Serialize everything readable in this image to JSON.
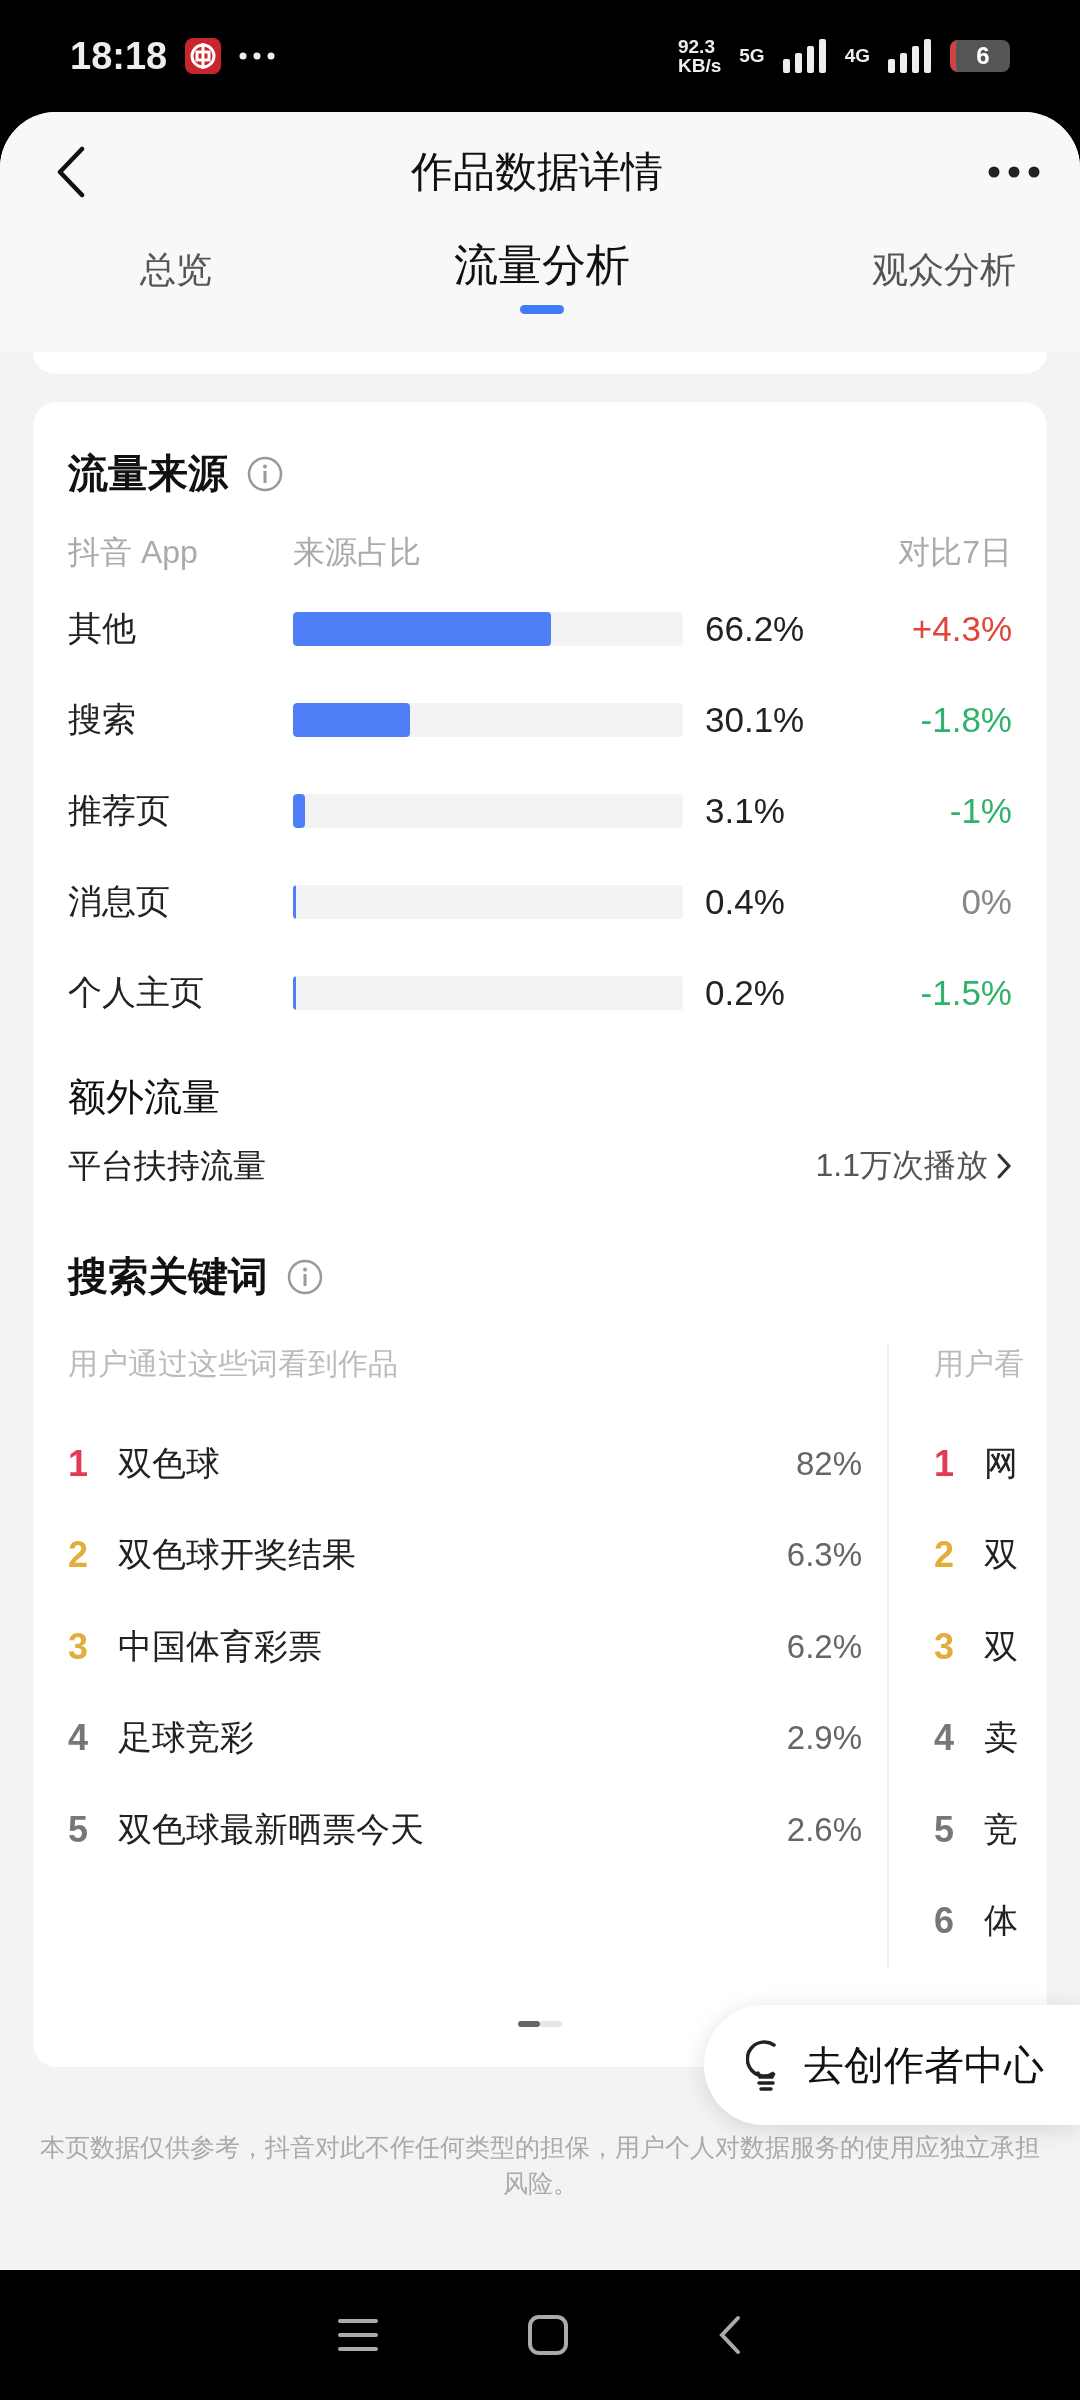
{
  "status_bar": {
    "time": "18:18",
    "net_speed": "92.3",
    "net_speed_unit": "KB/s",
    "sim1": "5G",
    "sim2": "4G",
    "battery": "6"
  },
  "header": {
    "title": "作品数据详情"
  },
  "tabs": [
    {
      "label": "总览",
      "selected": false
    },
    {
      "label": "流量分析",
      "selected": true
    },
    {
      "label": "观众分析",
      "selected": false
    }
  ],
  "traffic_sources": {
    "title": "流量来源",
    "columns": [
      "抖音 App",
      "来源占比",
      "对比7日"
    ],
    "rows": [
      {
        "name": "其他",
        "level": 0.662,
        "share": "66.2%",
        "change": "+4.3%",
        "color": "#e0453a"
      },
      {
        "name": "搜索",
        "level": 0.301,
        "share": "30.1%",
        "change": "-1.8%",
        "color": "#2fb36a"
      },
      {
        "name": "推荐页",
        "level": 0.031,
        "share": "3.1%",
        "change": "-1%",
        "color": "#2fb36a"
      },
      {
        "name": "消息页",
        "level": 0.004,
        "share": "0.4%",
        "change": "0%",
        "color": "#888888"
      },
      {
        "name": "个人主页",
        "level": 0.002,
        "share": "0.2%",
        "change": "-1.5%",
        "color": "#2fb36a"
      }
    ]
  },
  "extra_traffic": {
    "title": "额外流量",
    "label": "平台扶持流量",
    "value": "1.1万次播放"
  },
  "search_keywords": {
    "title": "搜索关键词",
    "panels": [
      {
        "heading": "用户通过这些词看到作品",
        "items": [
          {
            "rank": "1",
            "keyword": "双色球",
            "share": "82%"
          },
          {
            "rank": "2",
            "keyword": "双色球开奖结果",
            "share": "6.3%"
          },
          {
            "rank": "3",
            "keyword": "中国体育彩票",
            "share": "6.2%"
          },
          {
            "rank": "4",
            "keyword": "足球竞彩",
            "share": "2.9%"
          },
          {
            "rank": "5",
            "keyword": "双色球最新晒票今天",
            "share": "2.6%"
          }
        ]
      },
      {
        "heading": "用户看",
        "items": [
          {
            "rank": "1",
            "keyword": "网"
          },
          {
            "rank": "2",
            "keyword": "双"
          },
          {
            "rank": "3",
            "keyword": "双"
          },
          {
            "rank": "4",
            "keyword": "卖"
          },
          {
            "rank": "5",
            "keyword": "竞"
          },
          {
            "rank": "6",
            "keyword": "体"
          }
        ]
      }
    ],
    "pager": [
      {
        "selected": true
      },
      {
        "selected": false
      }
    ]
  },
  "float_button": {
    "label": "去创作者中心"
  },
  "disclaimer": "本页数据仅供参考，抖音对此不作任何类型的担保，用户个人对数据服务的使用应独立承担风险。"
}
